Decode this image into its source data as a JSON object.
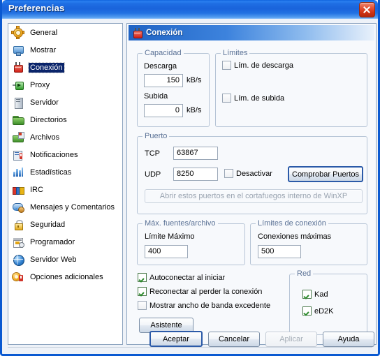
{
  "window": {
    "title": "Preferencias",
    "close_label": "×"
  },
  "sidebar": {
    "items": [
      {
        "label": "General",
        "icon": "gear-icon",
        "selected": false
      },
      {
        "label": "Mostrar",
        "icon": "monitor-icon",
        "selected": false
      },
      {
        "label": "Conexión",
        "icon": "plug-icon",
        "selected": true
      },
      {
        "label": "Proxy",
        "icon": "proxy-plug-icon",
        "selected": false
      },
      {
        "label": "Servidor",
        "icon": "server-icon",
        "selected": false
      },
      {
        "label": "Directorios",
        "icon": "folder-icon",
        "selected": false
      },
      {
        "label": "Archivos",
        "icon": "files-icon",
        "selected": false
      },
      {
        "label": "Notificaciones",
        "icon": "notification-icon",
        "selected": false
      },
      {
        "label": "Estadísticas",
        "icon": "statistics-icon",
        "selected": false
      },
      {
        "label": "IRC",
        "icon": "irc-icon",
        "selected": false
      },
      {
        "label": "Mensajes y Comentarios",
        "icon": "message-icon",
        "selected": false
      },
      {
        "label": "Seguridad",
        "icon": "padlock-icon",
        "selected": false
      },
      {
        "label": "Programador",
        "icon": "calendar-icon",
        "selected": false
      },
      {
        "label": "Servidor Web",
        "icon": "globe-icon",
        "selected": false
      },
      {
        "label": "Opciones adicionales",
        "icon": "extra-options-icon",
        "selected": false
      }
    ]
  },
  "pane": {
    "header_title": "Conexión",
    "capacidad": {
      "legend": "Capacidad",
      "descarga_label": "Descarga",
      "descarga_value": "150",
      "descarga_unit": "kB/s",
      "subida_label": "Subida",
      "subida_value": "0",
      "subida_unit": "kB/s"
    },
    "limites": {
      "legend": "Límites",
      "lim_descarga_label": "Lím. de descarga",
      "lim_descarga_checked": false,
      "lim_subida_label": "Lím. de subida",
      "lim_subida_checked": false
    },
    "puerto": {
      "legend": "Puerto",
      "tcp_label": "TCP",
      "tcp_value": "63867",
      "udp_label": "UDP",
      "udp_value": "8250",
      "desactivar_label": "Desactivar",
      "desactivar_checked": false,
      "comprobar_button": "Comprobar Puertos",
      "firewall_button": "Abrir estos puertos en el cortafuegos interno de WinXP"
    },
    "max_fuentes": {
      "legend": "Máx. fuentes/archivo",
      "limite_label": "Límite Máximo",
      "limite_value": "400"
    },
    "limites_conexion": {
      "legend": "Límites de conexión",
      "conexiones_label": "Conexiones máximas",
      "conexiones_value": "500"
    },
    "options": {
      "autoconectar_label": "Autoconectar al iniciar",
      "autoconectar_checked": true,
      "reconectar_label": "Reconectar al perder la conexión",
      "reconectar_checked": true,
      "ancho_banda_label": "Mostrar ancho de banda excedente",
      "ancho_banda_checked": false,
      "asistente_button": "Asistente"
    },
    "red": {
      "legend": "Red",
      "kad_label": "Kad",
      "kad_checked": true,
      "ed2k_label": "eD2K",
      "ed2k_checked": true
    }
  },
  "footer": {
    "accept_label": "Aceptar",
    "cancel_label": "Cancelar",
    "apply_label": "Aplicar",
    "help_label": "Ayuda"
  },
  "colors": {
    "title_bar_blue": "#1963db",
    "selection_blue": "#0a246a",
    "group_label": "#5b7296",
    "check_green": "#2e8b2e",
    "close_red": "#cf3214"
  }
}
